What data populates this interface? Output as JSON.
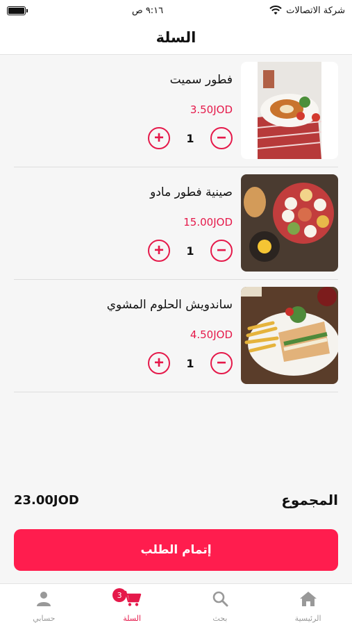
{
  "status_bar": {
    "carrier": "شركة الاتصالات",
    "time": "٩:١٦ ص"
  },
  "header": {
    "title": "السلة"
  },
  "items": [
    {
      "name": "فطور سميت",
      "price": "3.50JOD",
      "qty": "1"
    },
    {
      "name": "صينية فطور مادو",
      "price": "15.00JOD",
      "qty": "1"
    },
    {
      "name": "ساندويش الحلوم المشوي",
      "price": "4.50JOD",
      "qty": "1"
    }
  ],
  "total": {
    "label": "المجموع",
    "value": "23.00JOD"
  },
  "checkout": {
    "label": "إتمام الطلب"
  },
  "tabs": [
    {
      "label": "الرئيسية",
      "icon": "home-icon"
    },
    {
      "label": "بحث",
      "icon": "search-icon"
    },
    {
      "label": "السلة",
      "icon": "cart-icon",
      "badge": "3"
    },
    {
      "label": "حسابي",
      "icon": "user-icon"
    }
  ],
  "colors": {
    "accent": "#e5194a",
    "button": "#ff1d4e",
    "inactive": "#999999"
  }
}
